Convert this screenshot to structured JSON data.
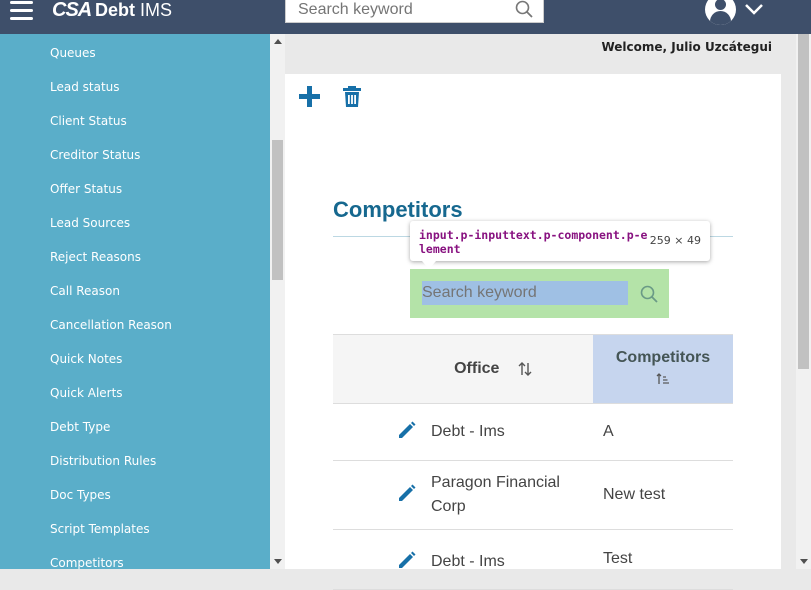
{
  "header": {
    "logo_text": "CSA",
    "brand_name": "Debt",
    "brand_suffix": "IMS",
    "search_placeholder": "Search keyword",
    "welcome": "Welcome, Julio Uzcátegui"
  },
  "sidebar": {
    "items": [
      {
        "label": "Queues"
      },
      {
        "label": "Lead status"
      },
      {
        "label": "Client Status"
      },
      {
        "label": "Creditor Status"
      },
      {
        "label": "Offer Status"
      },
      {
        "label": "Lead Sources"
      },
      {
        "label": "Reject Reasons"
      },
      {
        "label": "Call Reason"
      },
      {
        "label": "Cancellation Reason"
      },
      {
        "label": "Quick Notes"
      },
      {
        "label": "Quick Alerts"
      },
      {
        "label": "Debt Type"
      },
      {
        "label": "Distribution Rules"
      },
      {
        "label": "Doc Types"
      },
      {
        "label": "Script Templates"
      },
      {
        "label": "Competitors"
      }
    ]
  },
  "main": {
    "title": "Competitors",
    "toolbar": {
      "add_icon": "plus-icon",
      "delete_icon": "trash-icon"
    },
    "search_placeholder": "Search keyword",
    "devtools_tooltip": {
      "selector": "input.p-inputtext.p-component.p-element",
      "dims": "259 × 49"
    },
    "table": {
      "columns": [
        "Office",
        "Competitors"
      ],
      "rows": [
        {
          "office": "Debt - Ims",
          "competitor": "A"
        },
        {
          "office": "Paragon Financial Corp",
          "competitor": "New test"
        },
        {
          "office": "Debt - Ims",
          "competitor": "Test"
        }
      ]
    }
  },
  "colors": {
    "header_bg": "#3e4f6a",
    "sidebar_bg": "#5aaec9",
    "accent": "#16688f",
    "icon_blue": "#1770a8",
    "sorted_column_bg": "#c6d5ee",
    "highlight_green": "#b4e3a8"
  }
}
